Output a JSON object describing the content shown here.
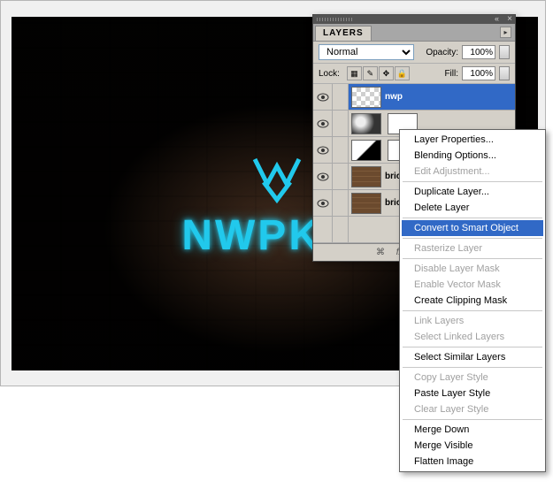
{
  "canvas_text": "NWPK.O",
  "panel": {
    "tab": "LAYERS",
    "blend_mode": "Normal",
    "opacity_label": "Opacity:",
    "opacity_value": "100%",
    "lock_label": "Lock:",
    "fill_label": "Fill:",
    "fill_value": "100%"
  },
  "layers": [
    {
      "name": "nwp",
      "thumb": "trans",
      "selected": true
    },
    {
      "name": "",
      "thumb": "clouds",
      "thumb2": "white"
    },
    {
      "name": "",
      "thumb": "white",
      "thumb2": "white"
    },
    {
      "name": "brick",
      "thumb": "brick"
    },
    {
      "name": "brick",
      "thumb": "brick"
    }
  ],
  "context_menu": [
    {
      "label": "Layer Properties...",
      "enabled": true
    },
    {
      "label": "Blending Options...",
      "enabled": true
    },
    {
      "label": "Edit Adjustment...",
      "enabled": false
    },
    {
      "sep": true
    },
    {
      "label": "Duplicate Layer...",
      "enabled": true
    },
    {
      "label": "Delete Layer",
      "enabled": true
    },
    {
      "sep": true
    },
    {
      "label": "Convert to Smart Object",
      "enabled": true,
      "highlight": true
    },
    {
      "sep": true
    },
    {
      "label": "Rasterize Layer",
      "enabled": false
    },
    {
      "sep": true
    },
    {
      "label": "Disable Layer Mask",
      "enabled": false
    },
    {
      "label": "Enable Vector Mask",
      "enabled": false
    },
    {
      "label": "Create Clipping Mask",
      "enabled": true
    },
    {
      "sep": true
    },
    {
      "label": "Link Layers",
      "enabled": false
    },
    {
      "label": "Select Linked Layers",
      "enabled": false
    },
    {
      "sep": true
    },
    {
      "label": "Select Similar Layers",
      "enabled": true
    },
    {
      "sep": true
    },
    {
      "label": "Copy Layer Style",
      "enabled": false
    },
    {
      "label": "Paste Layer Style",
      "enabled": true
    },
    {
      "label": "Clear Layer Style",
      "enabled": false
    },
    {
      "sep": true
    },
    {
      "label": "Merge Down",
      "enabled": true
    },
    {
      "label": "Merge Visible",
      "enabled": true
    },
    {
      "label": "Flatten Image",
      "enabled": true
    }
  ]
}
